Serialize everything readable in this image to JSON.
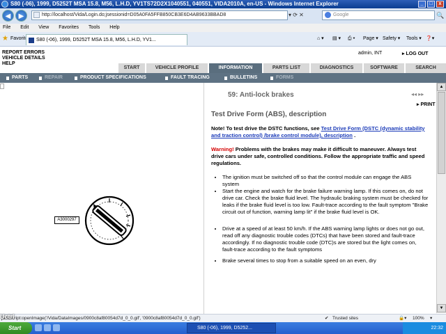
{
  "window": {
    "title": "S80 (-06), 1999, D5252T MSA 15.8, M56, L.H.D, YV1TS72D2X1040551, 040551, VIDA2010A, en-US - Windows Internet Explorer",
    "buttons": [
      "_",
      "□",
      "x"
    ]
  },
  "address_bar": {
    "back_label": "◀",
    "forward_label": "▶",
    "url": "http://localhost/Vida/Login.do;jsessionid=D05A0FA5FFB850CB3E6D4AB9633BBAD8",
    "tools_label": "▾ ⟳ ✕",
    "search_placeholder": "Google",
    "search_go": "🔍"
  },
  "menubar": [
    "File",
    "Edit",
    "View",
    "Favorites",
    "Tools",
    "Help"
  ],
  "favorites_bar": {
    "label": "Favorites",
    "tab_title": "S80 (-06), 1999, D5252T MSA 15.8, M56, L.H.D, YV1...",
    "tools": [
      "Page ▾",
      "Safety ▾",
      "Tools ▾",
      "❓▾"
    ]
  },
  "app": {
    "links": [
      "REPORT ERRORS",
      "VEHICLE DETAILS",
      "HELP"
    ],
    "user": "admin, INT",
    "logout": "LOG OUT",
    "tabs": [
      "START",
      "VEHICLE PROFILE",
      "INFORMATION",
      "PARTS LIST",
      "DIAGNOSTICS",
      "SOFTWARE",
      "SEARCH"
    ],
    "active_tab": "INFORMATION",
    "subnav": [
      "PARTS",
      "REPAIR",
      "PRODUCT SPECIFICATIONS",
      "FAULT TRACING",
      "BULLETINS",
      "FORMS"
    ],
    "active_subnav": "REPAIR"
  },
  "image_panel": {
    "image_ref": "A3000297",
    "image_desc_icon": "brake-warning-lamp-dial"
  },
  "document": {
    "section_title": "59: Anti-lock brakes",
    "nav_arrows": "◂◂ ▸▸",
    "print_label": "PRINT",
    "form_title": "Test Drive Form (ABS), description",
    "note_prefix": "Note! To test drive the DSTC functions, see ",
    "note_link": "Test Drive Form (DSTC (dynamic stability and traction control) /brake control module), description",
    "note_suffix": " .",
    "warning_head": "Warning!",
    "warning_text": " Problems with the brakes may make it difficult to maneuver. Always test drive cars under safe, controlled conditions. Follow the appropriate traffic and speed regulations.",
    "bullets": [
      "The ignition must be switched off so that the control module can engage the ABS system",
      "Start the engine and watch for the brake failure warning lamp. If this comes on, do not drive car. Check the brake fluid level. The hydraulic braking system must be checked for leaks if the brake fluid level is too low. Fault-trace according to the fault symptom \"Brake circuit out of function, warning lamp lit\" if the brake fluid level is OK.",
      "Drive at a speed of at least 50 km/h. If the ABS warning lamp lights or does not go out, read off any diagnostic trouble codes (DTCs) that have been stored and fault-trace accordingly. If no diagnostic trouble code (DTC)s are stored but the light comes on, fault-trace according to the fault symptoms",
      "Brake several times to stop from a suitable speed on an even, dry"
    ]
  },
  "statusbar": {
    "text": "javascript:openImage('/Vida/DataImages/0900c8af80054d7d_0_0.gif', '0900c8af80054d7d_0_0.gif')",
    "zone": "Trusted sites",
    "zoom": "100%"
  },
  "taskbar": {
    "start": "Start",
    "task_item": "S80 (-06), 1999, D5252...",
    "clock": "22:32"
  },
  "watermark": "Uctrl"
}
